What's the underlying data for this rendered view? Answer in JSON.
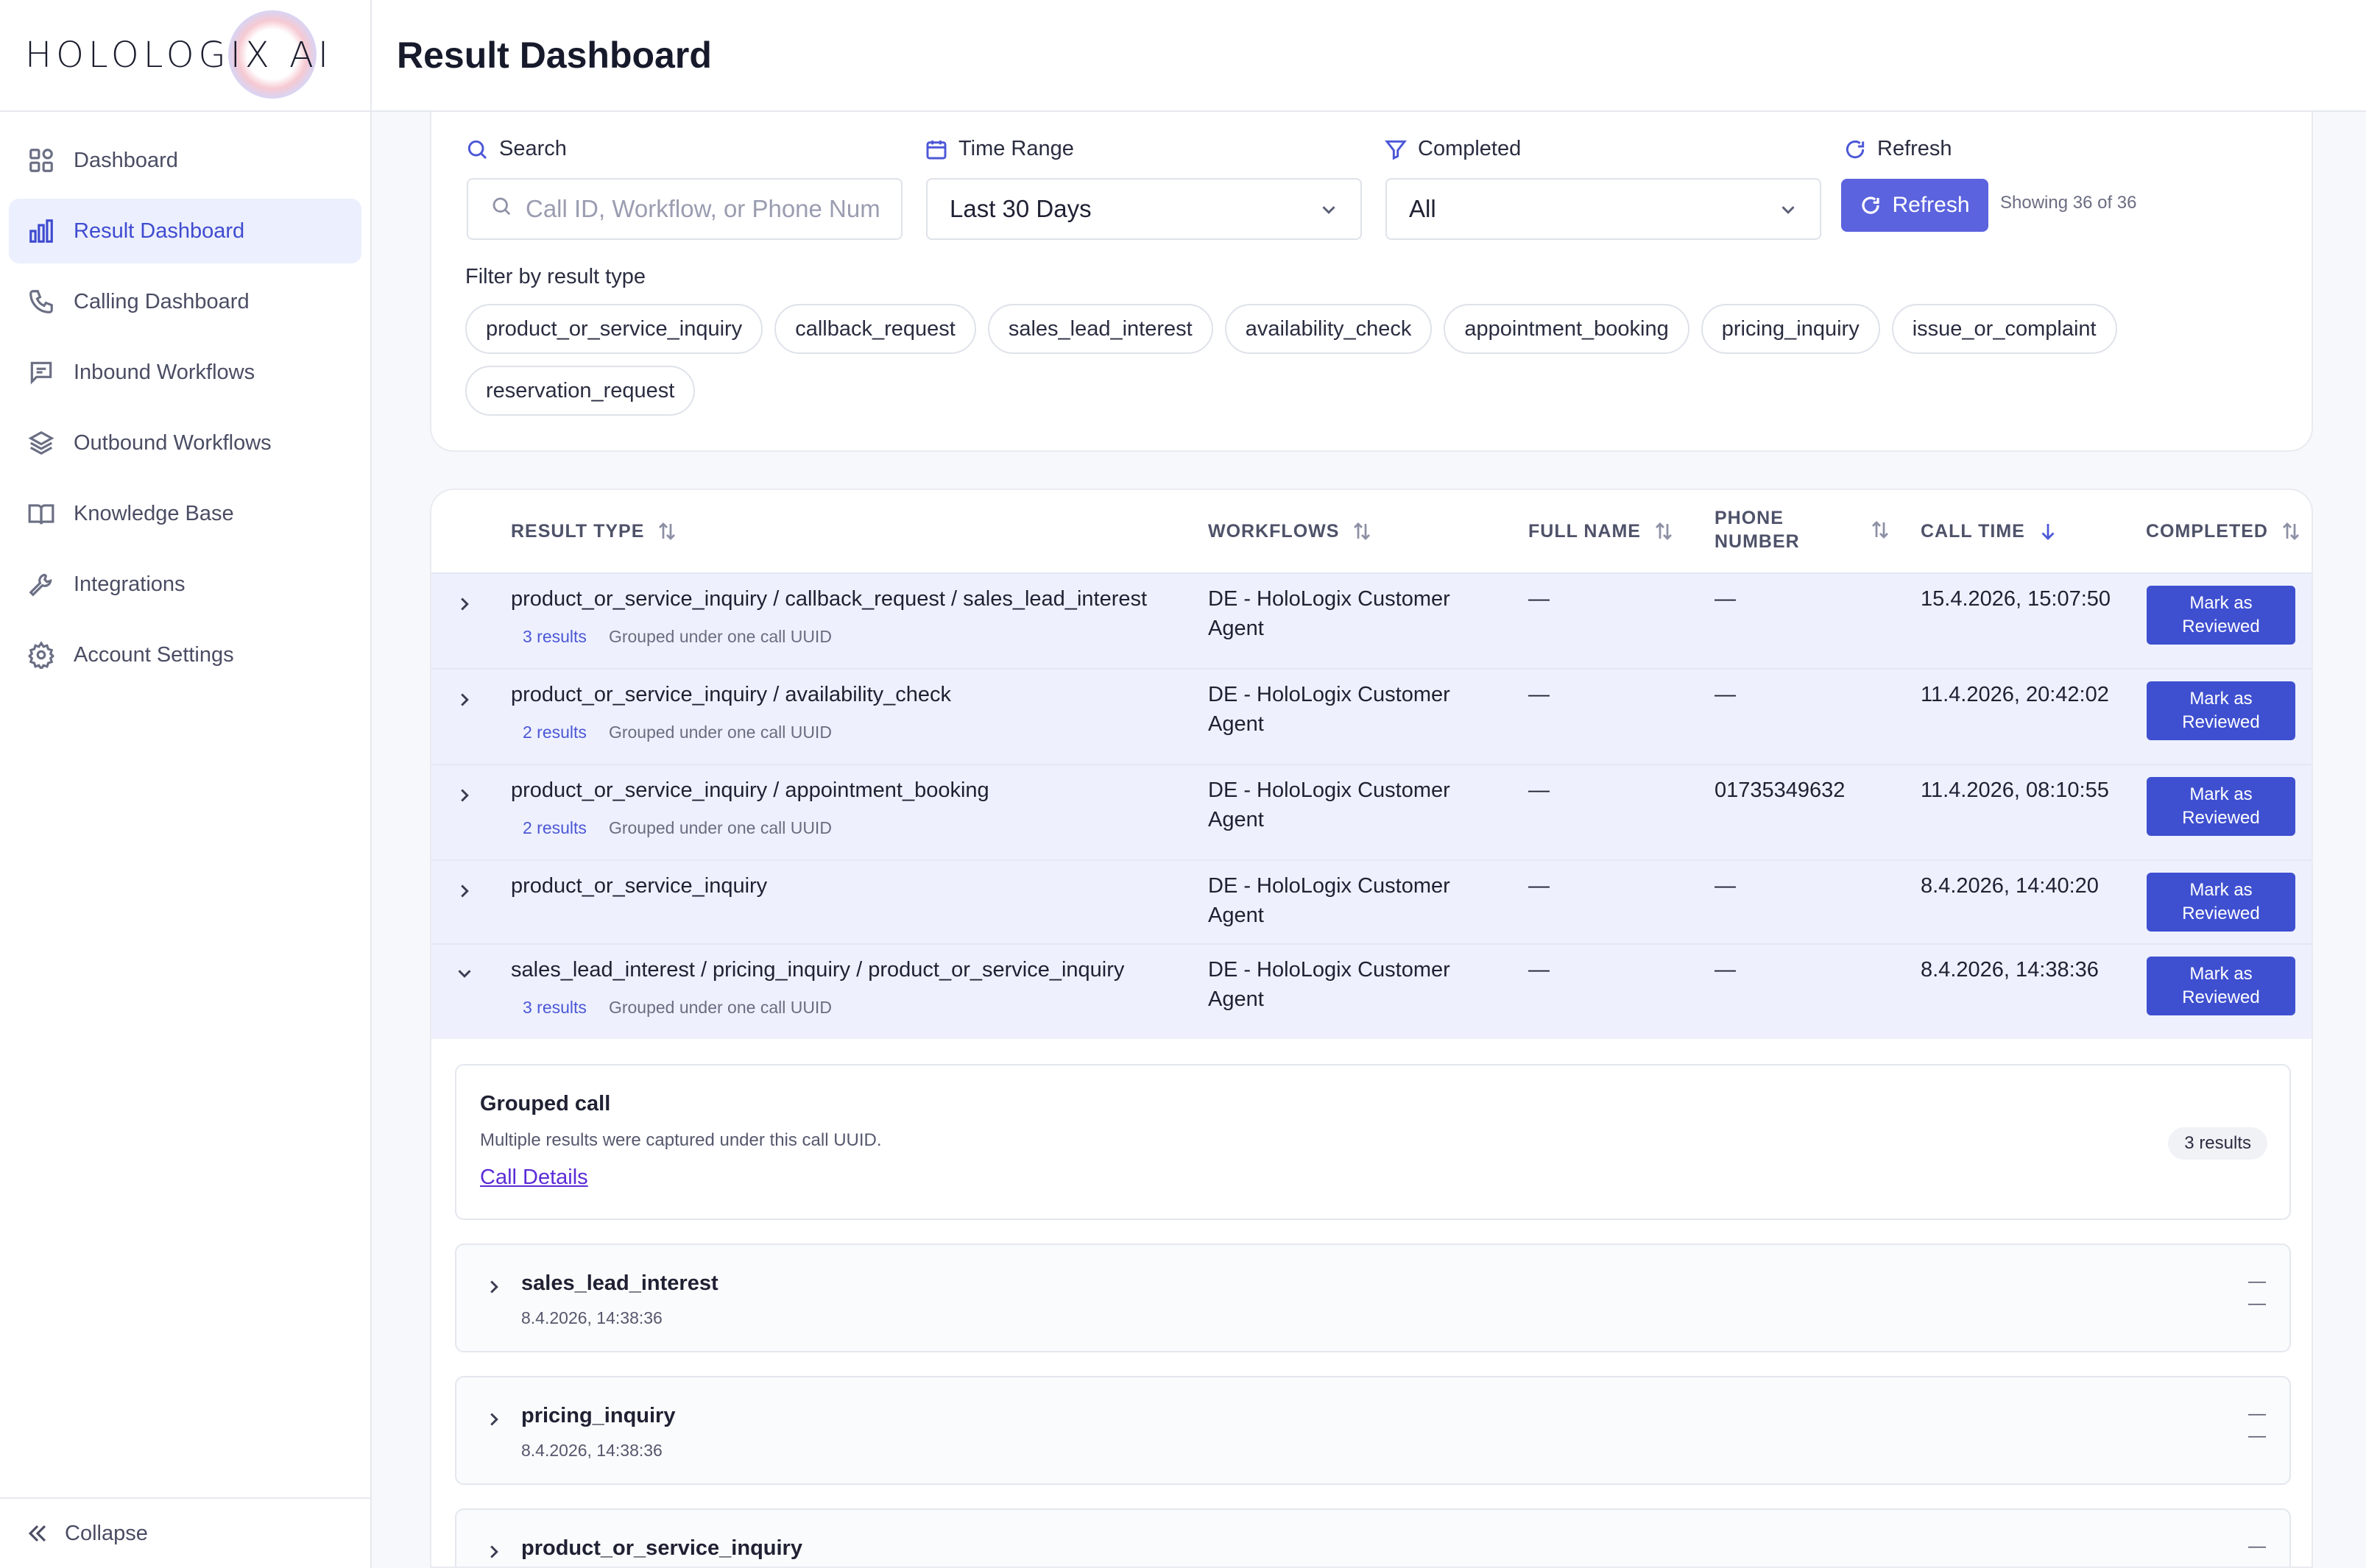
{
  "brand": {
    "logo_text": "HOLOLOGIX AI"
  },
  "sidebar": {
    "items": [
      {
        "label": "Dashboard",
        "icon": "grid-icon",
        "active": false
      },
      {
        "label": "Result Dashboard",
        "icon": "bar-chart-icon",
        "active": true
      },
      {
        "label": "Calling Dashboard",
        "icon": "phone-icon",
        "active": false
      },
      {
        "label": "Inbound Workflows",
        "icon": "chat-icon",
        "active": false
      },
      {
        "label": "Outbound Workflows",
        "icon": "layers-icon",
        "active": false
      },
      {
        "label": "Knowledge Base",
        "icon": "book-icon",
        "active": false
      },
      {
        "label": "Integrations",
        "icon": "wrench-icon",
        "active": false
      },
      {
        "label": "Account Settings",
        "icon": "gear-icon",
        "active": false
      }
    ],
    "collapse_label": "Collapse"
  },
  "header": {
    "title": "Result Dashboard"
  },
  "filters": {
    "search_label": "Search",
    "search_placeholder": "Call ID, Workflow, or Phone Number",
    "time_label": "Time Range",
    "time_value": "Last 30 Days",
    "completed_label": "Completed",
    "completed_value": "All",
    "refresh_label": "Refresh",
    "refresh_button": "Refresh",
    "showing": "Showing 36 of 36",
    "filter_by_label": "Filter by result type",
    "result_types": [
      "product_or_service_inquiry",
      "callback_request",
      "sales_lead_interest",
      "availability_check",
      "appointment_booking",
      "pricing_inquiry",
      "issue_or_complaint",
      "reservation_request"
    ]
  },
  "table": {
    "columns": {
      "result_type": "RESULT TYPE",
      "workflows": "WORKFLOWS",
      "full_name": "FULL NAME",
      "phone_line1": "PHONE",
      "phone_line2": "NUMBER",
      "call_time": "CALL TIME",
      "completed": "COMPLETED"
    },
    "mark_label_1": "Mark as",
    "mark_label_2": "Reviewed",
    "grouped_note": "Grouped under one call UUID",
    "rows": [
      {
        "result_type": "product_or_service_inquiry / callback_request / sales_lead_interest",
        "count": "3 results",
        "workflow_1": "DE - HoloLogix Customer",
        "workflow_2": "Agent",
        "full_name": "—",
        "phone": "—",
        "call_time": "15.4.2026, 15:07:50",
        "expanded": false
      },
      {
        "result_type": "product_or_service_inquiry / availability_check",
        "count": "2 results",
        "workflow_1": "DE - HoloLogix Customer",
        "workflow_2": "Agent",
        "full_name": "—",
        "phone": "—",
        "call_time": "11.4.2026, 20:42:02",
        "expanded": false
      },
      {
        "result_type": "product_or_service_inquiry / appointment_booking",
        "count": "2 results",
        "workflow_1": "DE - HoloLogix Customer",
        "workflow_2": "Agent",
        "full_name": "—",
        "phone": "01735349632",
        "call_time": "11.4.2026, 08:10:55",
        "expanded": false
      },
      {
        "result_type": "product_or_service_inquiry",
        "count": "",
        "workflow_1": "DE - HoloLogix Customer",
        "workflow_2": "Agent",
        "full_name": "—",
        "phone": "—",
        "call_time": "8.4.2026, 14:40:20",
        "expanded": false
      },
      {
        "result_type": "sales_lead_interest / pricing_inquiry / product_or_service_inquiry",
        "count": "3 results",
        "workflow_1": "DE - HoloLogix Customer",
        "workflow_2": "Agent",
        "full_name": "—",
        "phone": "—",
        "call_time": "8.4.2026, 14:38:36",
        "expanded": true
      }
    ]
  },
  "grouped_call": {
    "title": "Grouped call",
    "description": "Multiple results were captured under this call UUID.",
    "link": "Call Details",
    "badge": "3 results",
    "results": [
      {
        "name": "sales_lead_interest",
        "time": "8.4.2026, 14:38:36",
        "dash1": "—",
        "dash2": "—"
      },
      {
        "name": "pricing_inquiry",
        "time": "8.4.2026, 14:38:36",
        "dash1": "—",
        "dash2": "—"
      },
      {
        "name": "product_or_service_inquiry",
        "time": "",
        "dash1": "—",
        "dash2": ""
      }
    ]
  },
  "colors": {
    "accent": "#3e4fd0",
    "active_bg": "#eceffd",
    "row_bg": "#eef1fd",
    "link": "#5b2bd6"
  }
}
